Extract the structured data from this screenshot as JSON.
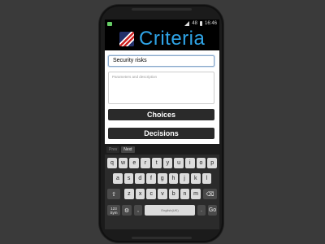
{
  "statusbar": {
    "battery": "48",
    "time": "16:46"
  },
  "app": {
    "title": "Criteria",
    "logo_icon": "app-logo-icon",
    "title_color": "#2fa4e7"
  },
  "form": {
    "name_value": "Security risks",
    "description_placeholder": "Parameters and description"
  },
  "buttons": {
    "choices": "Choices",
    "decisions": "Decisions"
  },
  "keyboard_bar": {
    "prev": "Prev",
    "next": "Next"
  },
  "keyboard": {
    "row1": [
      "q",
      "w",
      "e",
      "r",
      "t",
      "y",
      "u",
      "i",
      "o",
      "p"
    ],
    "row2": [
      "a",
      "s",
      "d",
      "f",
      "g",
      "h",
      "j",
      "k",
      "l"
    ],
    "row3": [
      "z",
      "x",
      "c",
      "v",
      "b",
      "n",
      "m"
    ],
    "shift_icon": "shift-icon",
    "backspace_icon": "backspace-icon",
    "sym_label": "123\nSym",
    "settings_icon": "gear-icon",
    "comma": ",",
    "space_label": "English(UK)",
    "period": ".",
    "go": "Go"
  }
}
